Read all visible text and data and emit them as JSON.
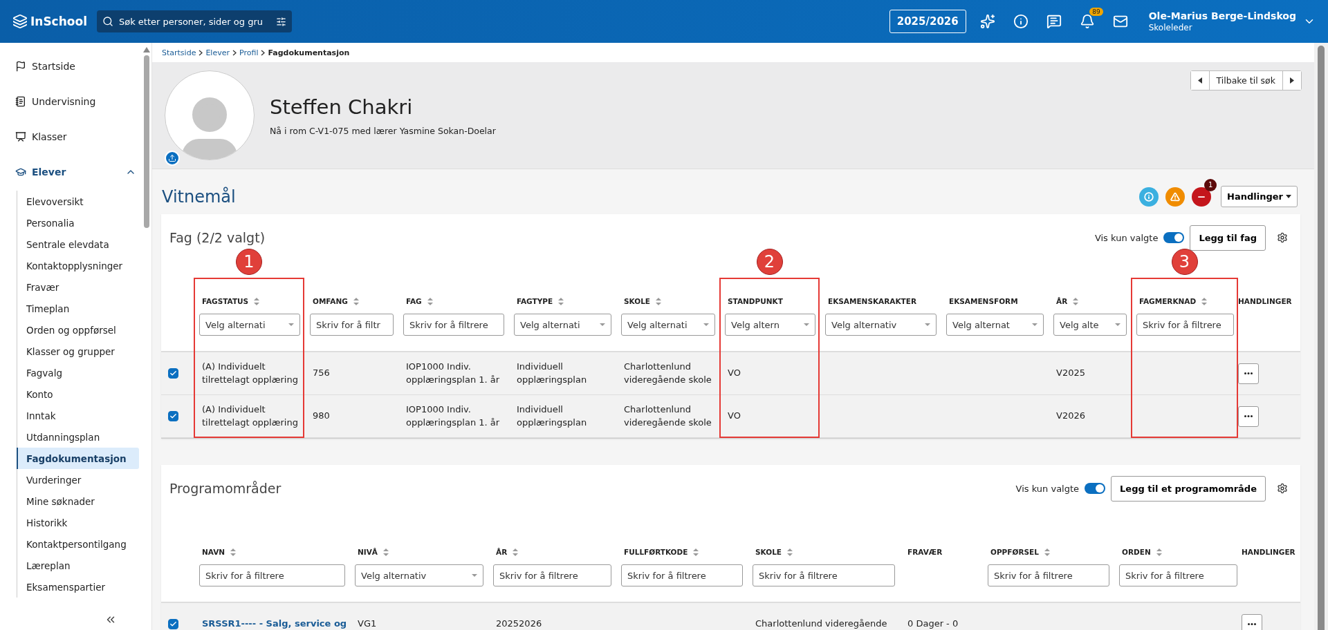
{
  "header": {
    "logo": "InSchool",
    "search": {
      "placeholder": "Søk etter personer, sider og gru"
    },
    "school_year": "2025/2026",
    "notification_count": "89",
    "user": {
      "name": "Ole-Marius Berge-Lindskog",
      "role": "Skoleleder"
    }
  },
  "sidebar": {
    "items": [
      {
        "label": "Startside",
        "expanded": false
      },
      {
        "label": "Undervisning",
        "expanded": false
      },
      {
        "label": "Klasser",
        "expanded": false
      },
      {
        "label": "Elever",
        "expanded": true,
        "children": [
          {
            "label": "Elevoversikt",
            "selected": false
          },
          {
            "label": "Personalia",
            "selected": false
          },
          {
            "label": "Sentrale elevdata",
            "selected": false
          },
          {
            "label": "Kontaktopplysninger",
            "selected": false
          },
          {
            "label": "Fravær",
            "selected": false
          },
          {
            "label": "Timeplan",
            "selected": false
          },
          {
            "label": "Orden og oppførsel",
            "selected": false
          },
          {
            "label": "Klasser og grupper",
            "selected": false
          },
          {
            "label": "Fagvalg",
            "selected": false
          },
          {
            "label": "Konto",
            "selected": false
          },
          {
            "label": "Inntak",
            "selected": false
          },
          {
            "label": "Utdanningsplan",
            "selected": false
          },
          {
            "label": "Fagdokumentasjon",
            "selected": true
          },
          {
            "label": "Vurderinger",
            "selected": false
          },
          {
            "label": "Mine søknader",
            "selected": false
          },
          {
            "label": "Historikk",
            "selected": false
          },
          {
            "label": "Kontaktpersontilgang",
            "selected": false
          },
          {
            "label": "Læreplan",
            "selected": false
          },
          {
            "label": "Eksamenspartier",
            "selected": false
          }
        ]
      }
    ]
  },
  "breadcrumb": [
    "Startside",
    "Elever",
    "Profil",
    "Fagdokumentasjon"
  ],
  "profile": {
    "name": "Steffen Chakri",
    "subtitle": "Nå i rom C-V1-075 med lærer Yasmine Sokan-Doelar",
    "back_button": "Tilbake til søk"
  },
  "section": {
    "title": "Vitnemål",
    "status_icons": [
      {
        "kind": "info"
      },
      {
        "kind": "warning"
      },
      {
        "kind": "error",
        "count": "1"
      }
    ],
    "actions_button": "Handlinger"
  },
  "tables": [
    {
      "title": "Fag (2/2 valgt)",
      "toggle": {
        "label": "Vis kun valgte",
        "on": true
      },
      "add_button": "Legg til fag",
      "columns": [
        {
          "label": "FAGSTATUS",
          "sortable": true,
          "filter": {
            "kind": "select",
            "placeholder": "Velg alternati"
          },
          "annotation": "1"
        },
        {
          "label": "OMFANG",
          "sortable": true,
          "filter": {
            "kind": "text",
            "placeholder": "Skriv for å filtr"
          }
        },
        {
          "label": "FAG",
          "sortable": true,
          "filter": {
            "kind": "text",
            "placeholder": "Skriv for å filtrere"
          }
        },
        {
          "label": "FAGTYPE",
          "sortable": true,
          "filter": {
            "kind": "select",
            "placeholder": "Velg alternati"
          }
        },
        {
          "label": "SKOLE",
          "sortable": true,
          "filter": {
            "kind": "select",
            "placeholder": "Velg alternati"
          }
        },
        {
          "label": "STANDPUNKT",
          "filter": {
            "kind": "select",
            "placeholder": "Velg altern"
          },
          "annotation": "2"
        },
        {
          "label": "EKSAMENSKARAKTER",
          "filter": {
            "kind": "select",
            "placeholder": "Velg alternativ"
          }
        },
        {
          "label": "EKSAMENSFORM",
          "filter": {
            "kind": "select",
            "placeholder": "Velg alternat"
          }
        },
        {
          "label": "ÅR",
          "sortable": true,
          "filter": {
            "kind": "select",
            "placeholder": "Velg alte"
          }
        },
        {
          "label": "FAGMERKNAD",
          "sortable": true,
          "filter": {
            "kind": "text",
            "placeholder": "Skriv for å filtrere"
          },
          "annotation": "3"
        },
        {
          "label": "HANDLINGER"
        }
      ],
      "rows": [
        {
          "selected": true,
          "fagstatus": "(A) Individuelt tilrettelagt opplæring",
          "omfang": "756",
          "fag": "IOP1000 Indiv. opplæringsplan 1. år",
          "fagtype": "Individuell opplæringsplan",
          "skole": "Charlottenlund videregående skole",
          "standpunkt": "VO",
          "ar": "V2025"
        },
        {
          "selected": true,
          "fagstatus": "(A) Individuelt tilrettelagt opplæring",
          "omfang": "980",
          "fag": "IOP1000 Indiv. opplæringsplan 1. år",
          "fagtype": "Individuell opplæringsplan",
          "skole": "Charlottenlund videregående skole",
          "standpunkt": "VO",
          "ar": "V2026"
        }
      ]
    },
    {
      "title": "Programområder",
      "toggle": {
        "label": "Vis kun valgte",
        "on": true
      },
      "add_button": "Legg til et programområde",
      "columns": [
        {
          "label": "NAVN",
          "sortable": true,
          "filter": {
            "kind": "text",
            "placeholder": "Skriv for å filtrere"
          }
        },
        {
          "label": "NIVÅ",
          "sortable": true,
          "filter": {
            "kind": "select",
            "placeholder": "Velg alternativ"
          }
        },
        {
          "label": "ÅR",
          "sortable": true,
          "filter": {
            "kind": "text",
            "placeholder": "Skriv for å filtrere"
          }
        },
        {
          "label": "FULLFØRTKODE",
          "sortable": true,
          "filter": {
            "kind": "text",
            "placeholder": "Skriv for å filtrere"
          }
        },
        {
          "label": "SKOLE",
          "sortable": true,
          "filter": {
            "kind": "text",
            "placeholder": "Skriv for å filtrere"
          }
        },
        {
          "label": "FRAVÆR"
        },
        {
          "label": "OPPFØRSEL",
          "sortable": true,
          "filter": {
            "kind": "text",
            "placeholder": "Skriv for å filtrere"
          }
        },
        {
          "label": "ORDEN",
          "sortable": true,
          "filter": {
            "kind": "text",
            "placeholder": "Skriv for å filtrere"
          }
        },
        {
          "label": "HANDLINGER"
        }
      ],
      "rows": [
        {
          "selected": true,
          "navn": "SRSSR1---- - Salg, service og",
          "niva": "VG1",
          "ar": "20252026",
          "skole": "Charlottenlund videregående",
          "fravaer": "0 Dager - 0"
        }
      ]
    }
  ]
}
